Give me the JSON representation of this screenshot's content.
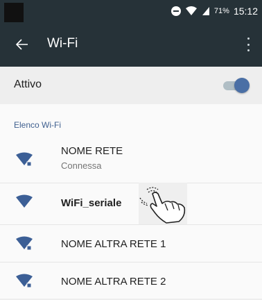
{
  "status_bar": {
    "battery": "71%",
    "time": "15:12"
  },
  "app_bar": {
    "title": "Wi-Fi"
  },
  "toggle": {
    "label": "Attivo",
    "state": "on"
  },
  "list": {
    "section_title": "Elenco Wi-Fi",
    "networks": [
      {
        "name": "NOME RETE",
        "status": "Connessa",
        "secured": true
      },
      {
        "name": "WiFi_seriale",
        "secured": false
      },
      {
        "name": "NOME ALTRA RETE 1",
        "secured": true
      },
      {
        "name": "NOME ALTRA RETE 2",
        "secured": true
      }
    ]
  },
  "colors": {
    "app_bar": "#263238",
    "wifi_icon": "#3c5f96",
    "toggle_thumb": "#4a6fa5"
  },
  "icons": [
    "back-arrow-icon",
    "more-icon",
    "wifi-icon",
    "lock-icon",
    "tap-hand-icon"
  ]
}
